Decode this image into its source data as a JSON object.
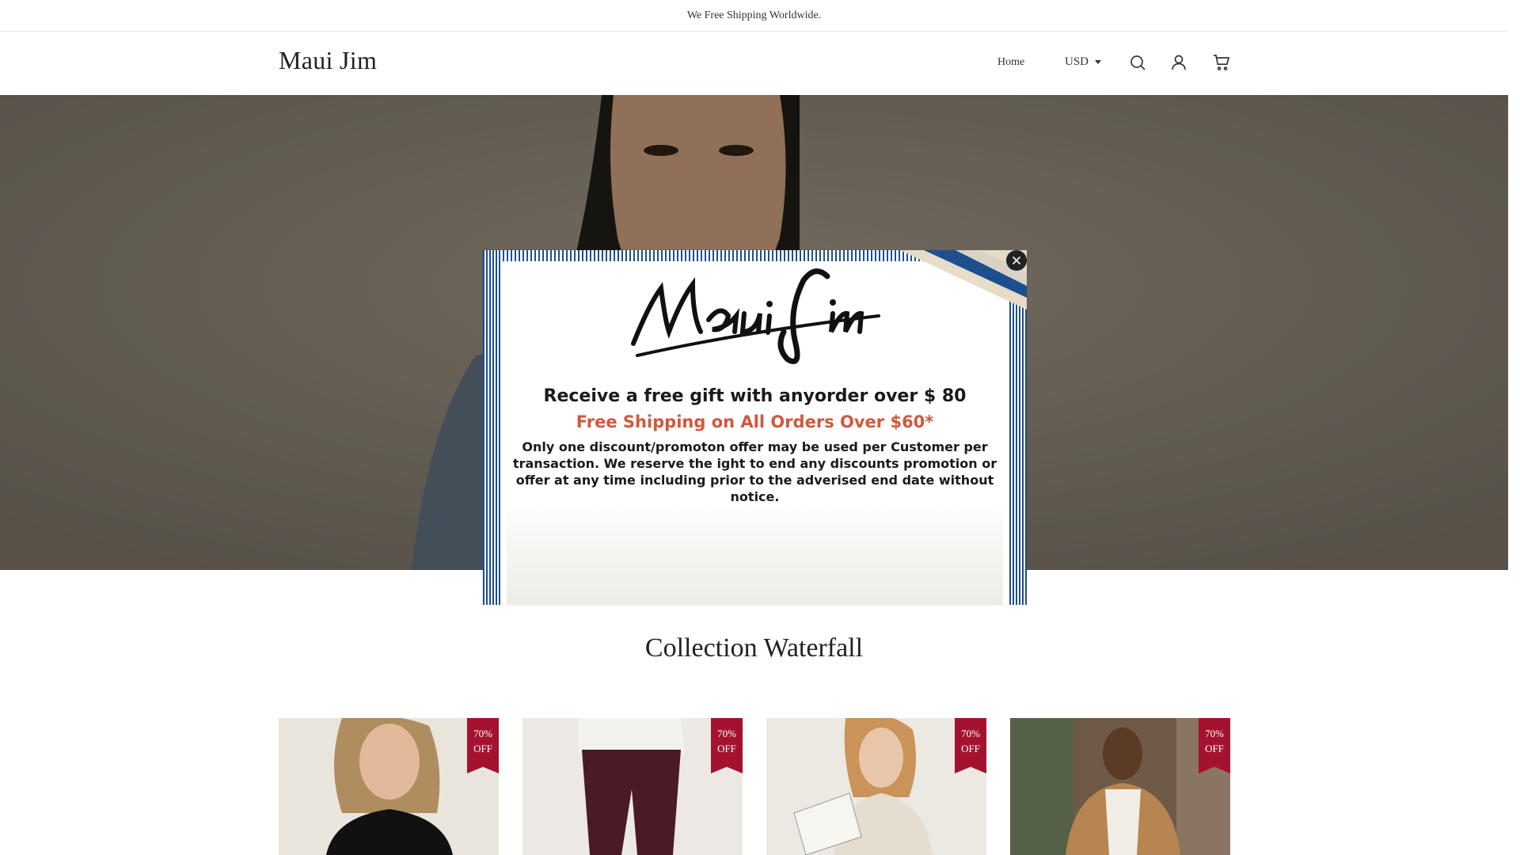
{
  "announcement": {
    "text": "We Free Shipping Worldwide."
  },
  "header": {
    "logo": "Maui Jim",
    "nav_home": "Home",
    "currency": "USD",
    "icons": [
      "search-icon",
      "account-icon",
      "cart-icon"
    ]
  },
  "popup": {
    "logo_text": "Maui Jim",
    "line1": "Receive a free gift with anyorder over $ 80",
    "line2": "Free Shipping on All Orders Over $60*",
    "terms": "Only one discount/promoton offer may be used per Customer per transaction. We reserve the ight to end any discounts promotion or offer at any time including prior to the adverised end date without notice.",
    "close_icon": "close-icon",
    "accent_color": "#1d4f8f",
    "highlight_color": "#d2573c"
  },
  "collection": {
    "title": "Collection Waterfall",
    "products": [
      {
        "badge_line1": "70%",
        "badge_line2": "OFF"
      },
      {
        "badge_line1": "70%",
        "badge_line2": "OFF"
      },
      {
        "badge_line1": "70%",
        "badge_line2": "OFF"
      },
      {
        "badge_line1": "70%",
        "badge_line2": "OFF"
      }
    ],
    "badge_color": "#a3132f"
  }
}
